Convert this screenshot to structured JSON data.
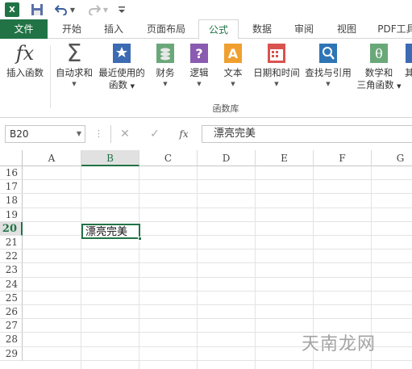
{
  "qat": {
    "logo": "X",
    "icons": [
      "excel-logo",
      "save-icon",
      "undo-icon",
      "redo-icon",
      "customize-icon"
    ]
  },
  "tabs": [
    "文件",
    "开始",
    "插入",
    "页面布局",
    "公式",
    "数据",
    "审阅",
    "视图",
    "PDF工具"
  ],
  "active_tab": "公式",
  "ribbon": {
    "buttons": [
      {
        "label": "插入函数",
        "icon": "fx"
      },
      {
        "label": "自动求和",
        "icon": "Σ"
      },
      {
        "label": "最近使用的",
        "label2": "函数"
      },
      {
        "label": "财务"
      },
      {
        "label": "逻辑"
      },
      {
        "label": "文本"
      },
      {
        "label": "日期和时间"
      },
      {
        "label": "查找与引用"
      },
      {
        "label": "数学和",
        "label2": "三角函数"
      },
      {
        "label": "其"
      }
    ],
    "group_label": "函数库"
  },
  "formula_bar": {
    "name_box": "B20",
    "dots": "⋮",
    "cancel": "✕",
    "confirm": "✓",
    "fx": "fx",
    "content": "漂亮完美"
  },
  "columns": [
    "A",
    "B",
    "C",
    "D",
    "E",
    "F",
    "G"
  ],
  "selected_column": "B",
  "rows": [
    "16",
    "17",
    "18",
    "19",
    "20",
    "21",
    "22",
    "23",
    "24",
    "25",
    "26",
    "27",
    "28",
    "29"
  ],
  "selected_row": "20",
  "active_cell": {
    "ref": "B20",
    "value": "漂亮完美"
  },
  "watermark": "天南龙网",
  "colors": {
    "accent": "#217346"
  }
}
